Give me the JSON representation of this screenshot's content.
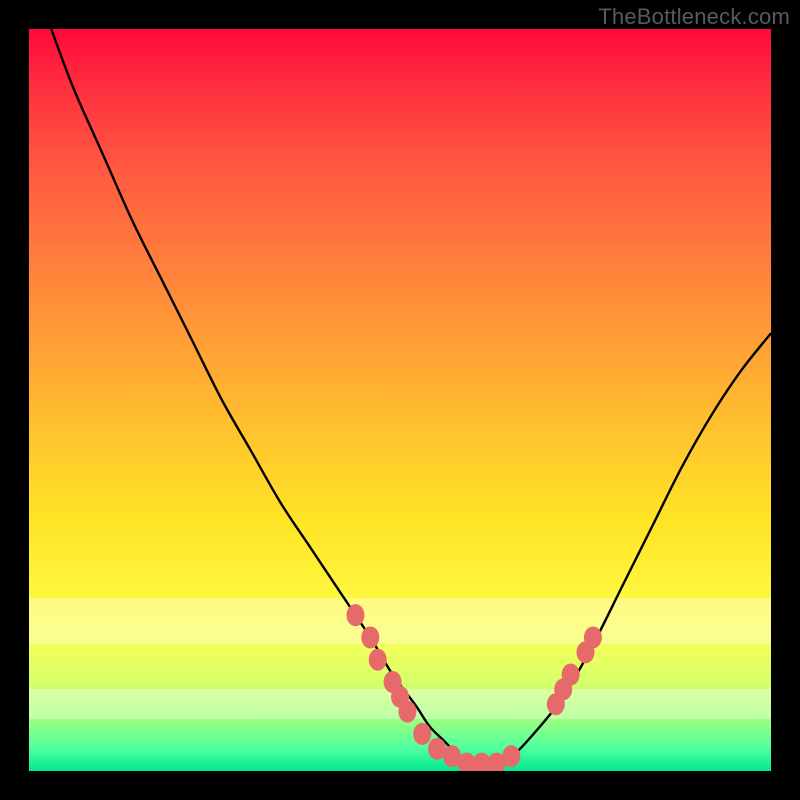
{
  "watermark": "TheBottleneck.com",
  "colors": {
    "curve_stroke": "#000000",
    "dot_fill": "#e66a6a",
    "dot_stroke": "#c94f4f"
  },
  "chart_data": {
    "type": "line",
    "title": "",
    "xlabel": "",
    "ylabel": "",
    "xlim": [
      0,
      100
    ],
    "ylim": [
      0,
      100
    ],
    "series": [
      {
        "name": "bottleneck-curve",
        "x": [
          3,
          6,
          10,
          14,
          18,
          22,
          26,
          30,
          34,
          38,
          42,
          46,
          49,
          52,
          54,
          56,
          58,
          60,
          62,
          65,
          68,
          72,
          76,
          80,
          84,
          88,
          92,
          96,
          100
        ],
        "y": [
          100,
          92,
          83,
          74,
          66,
          58,
          50,
          43,
          36,
          30,
          24,
          18,
          13,
          9,
          6,
          4,
          2,
          1,
          1,
          2,
          5,
          10,
          17,
          25,
          33,
          41,
          48,
          54,
          59
        ]
      }
    ],
    "dots": [
      {
        "x": 44,
        "y": 21
      },
      {
        "x": 46,
        "y": 18
      },
      {
        "x": 47,
        "y": 15
      },
      {
        "x": 49,
        "y": 12
      },
      {
        "x": 50,
        "y": 10
      },
      {
        "x": 51,
        "y": 8
      },
      {
        "x": 53,
        "y": 5
      },
      {
        "x": 55,
        "y": 3
      },
      {
        "x": 57,
        "y": 2
      },
      {
        "x": 59,
        "y": 1
      },
      {
        "x": 61,
        "y": 1
      },
      {
        "x": 63,
        "y": 1
      },
      {
        "x": 65,
        "y": 2
      },
      {
        "x": 71,
        "y": 9
      },
      {
        "x": 72,
        "y": 11
      },
      {
        "x": 73,
        "y": 13
      },
      {
        "x": 75,
        "y": 16
      },
      {
        "x": 76,
        "y": 18
      }
    ]
  }
}
